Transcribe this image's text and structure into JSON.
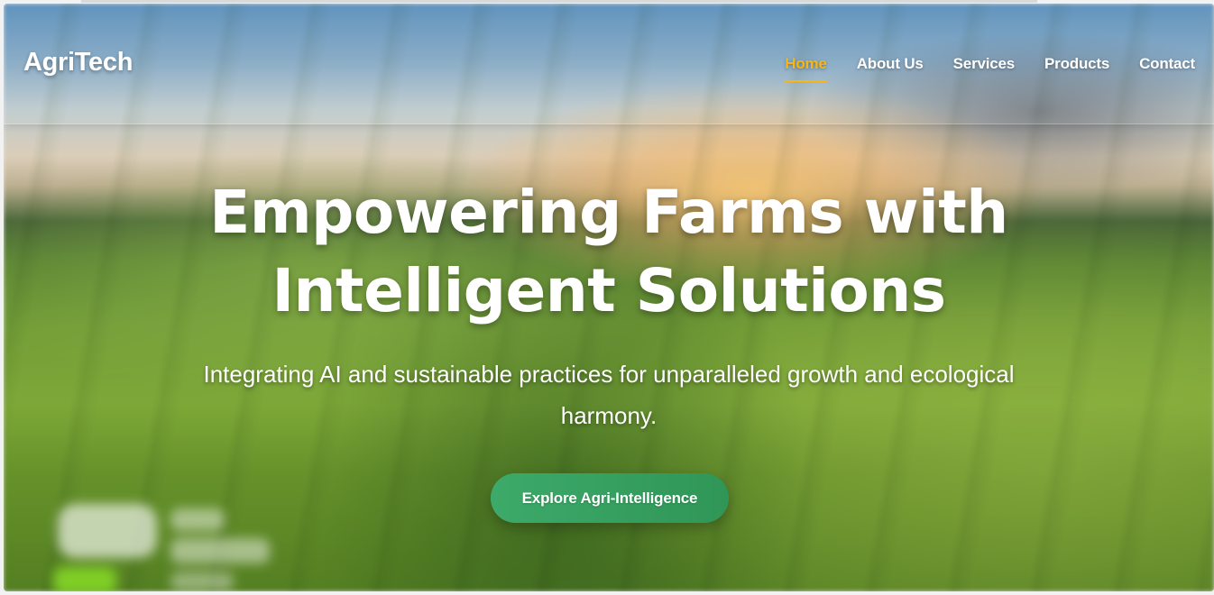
{
  "brand": {
    "logo_text": "AgriTech"
  },
  "nav": {
    "items": [
      {
        "label": "Home",
        "active": true
      },
      {
        "label": "About Us",
        "active": false
      },
      {
        "label": "Services",
        "active": false
      },
      {
        "label": "Products",
        "active": false
      },
      {
        "label": "Contact",
        "active": false
      }
    ]
  },
  "hero": {
    "title_line1": "Empowering Farms with",
    "title_line2": "Intelligent Solutions",
    "subtitle_line1": "Integrating AI and sustainable practices for unparalleled growth and ecological",
    "subtitle_line2": "harmony.",
    "cta_label": "Explore Agri-Intelligence"
  },
  "colors": {
    "accent_active": "#f7b614",
    "cta_green": "#3daa6a",
    "text": "#ffffff"
  }
}
